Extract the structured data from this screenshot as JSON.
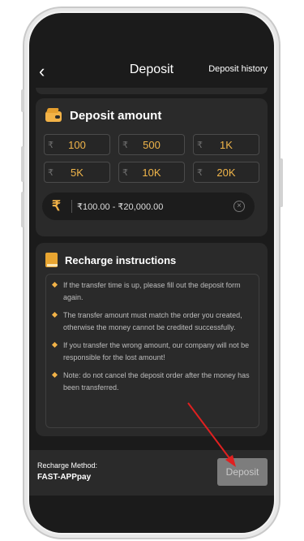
{
  "header": {
    "back_icon": "chevron-left-icon",
    "title": "Deposit",
    "history_label": "Deposit history"
  },
  "amount": {
    "title": "Deposit amount",
    "currency_symbol": "₹",
    "options": [
      "100",
      "500",
      "1K",
      "5K",
      "10K",
      "20K"
    ],
    "range_text": "₹100.00 - ₹20,000.00",
    "clear_icon": "close-circle-icon"
  },
  "instructions": {
    "title": "Recharge instructions",
    "items": [
      "If the transfer time is up, please fill out the deposit form again.",
      "The transfer amount must match the order you created, otherwise the money cannot be credited successfully.",
      "If you transfer the wrong amount, our company will not be responsible for the lost amount!",
      "Note: do not cancel the deposit order after the money has been transferred."
    ]
  },
  "footer": {
    "method_label": "Recharge Method:",
    "method_value": "FAST-APPpay",
    "deposit_label": "Deposit"
  },
  "colors": {
    "accent": "#f2b247",
    "background": "#1b1b1b",
    "card": "#2a2a2a",
    "arrow": "#e02020"
  }
}
